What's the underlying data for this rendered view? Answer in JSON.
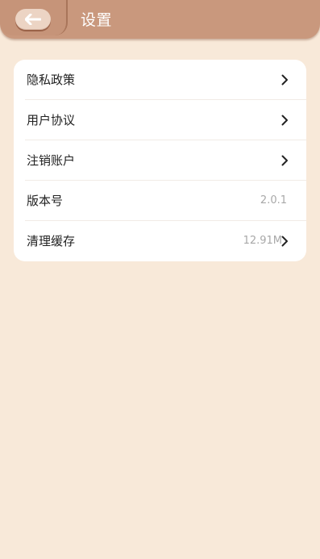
{
  "header": {
    "title": "设置",
    "back_icon": "back-arrow-icon"
  },
  "settings": {
    "items": [
      {
        "label": "隐私政策",
        "value": "",
        "chevron": true
      },
      {
        "label": "用户协议",
        "value": "",
        "chevron": true
      },
      {
        "label": "注销账户",
        "value": "",
        "chevron": true
      },
      {
        "label": "版本号",
        "value": "2.0.1",
        "chevron": false
      },
      {
        "label": "清理缓存",
        "value": "12.91M",
        "chevron": true
      }
    ]
  },
  "colors": {
    "background": "#f8e9d9",
    "header": "#c9987d",
    "card": "#ffffff",
    "text": "#222222",
    "muted": "#a8a8a8"
  }
}
